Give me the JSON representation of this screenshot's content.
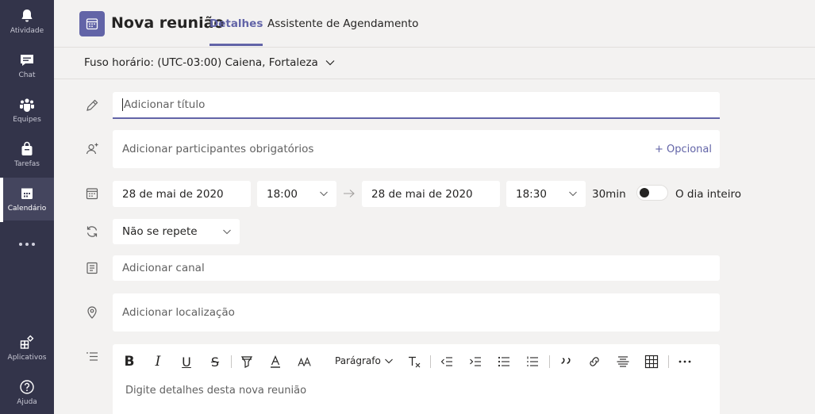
{
  "rail": {
    "items": [
      {
        "label": "Atividade",
        "icon": "bell-icon"
      },
      {
        "label": "Chat",
        "icon": "chat-icon"
      },
      {
        "label": "Equipes",
        "icon": "teams-icon"
      },
      {
        "label": "Tarefas",
        "icon": "tasks-icon"
      },
      {
        "label": "Calendário",
        "icon": "calendar-icon",
        "active": true
      }
    ],
    "more": "...",
    "bottom": [
      {
        "label": "Aplicativos",
        "icon": "apps-icon"
      },
      {
        "label": "Ajuda",
        "icon": "help-icon"
      }
    ]
  },
  "header": {
    "title": "Nova reunião",
    "tabs": [
      {
        "label": "Detalhes",
        "active": true
      },
      {
        "label": "Assistente de Agendamento"
      }
    ]
  },
  "timezone": {
    "label": "Fuso horário: (UTC-03:00) Caiena, Fortaleza"
  },
  "form": {
    "title_placeholder": "Adicionar título",
    "participants_placeholder": "Adicionar participantes obrigatórios",
    "optional_label": "+ Opcional",
    "start_date": "28 de mai de 2020",
    "start_time": "18:00",
    "end_date": "28 de mai de 2020",
    "end_time": "18:30",
    "duration": "30min",
    "all_day_label": "O dia inteiro",
    "all_day_on": false,
    "repeat": "Não se repete",
    "channel_placeholder": "Adicionar canal",
    "location_placeholder": "Adicionar localização"
  },
  "editor": {
    "paragraph_label": "Parágrafo",
    "placeholder": "Digite detalhes desta nova reunião"
  },
  "colors": {
    "accent": "#6264a7",
    "rail_bg": "#33344a",
    "page_bg": "#f3f2f1"
  }
}
